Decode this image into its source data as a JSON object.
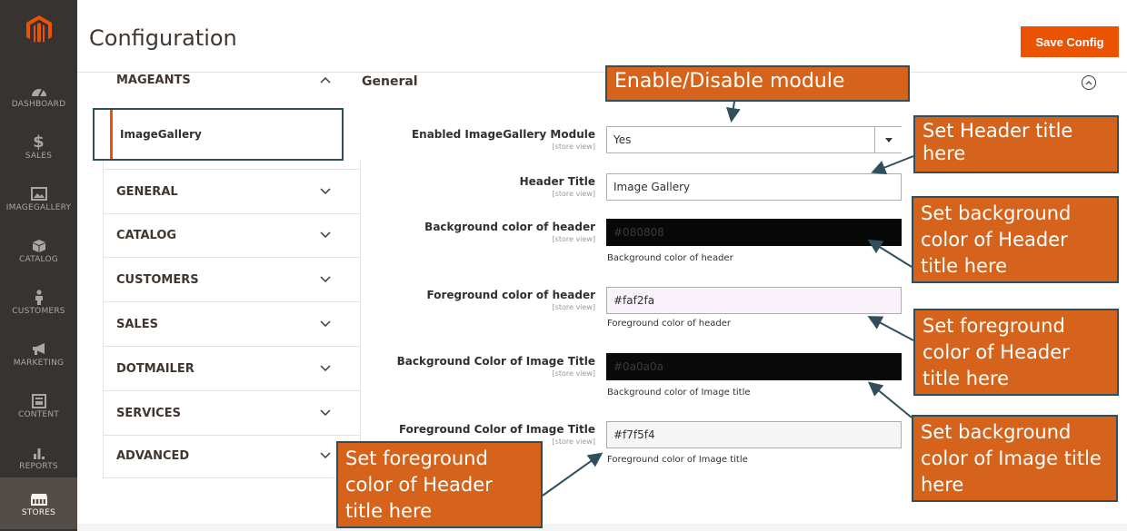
{
  "admin_nav": {
    "logo": "magento-logo",
    "items": [
      {
        "label": "DASHBOARD",
        "icon": "dashboard-icon"
      },
      {
        "label": "SALES",
        "icon": "dollar-icon"
      },
      {
        "label": "IMAGEGALLERY",
        "icon": "image-icon"
      },
      {
        "label": "CATALOG",
        "icon": "box-icon"
      },
      {
        "label": "CUSTOMERS",
        "icon": "person-icon"
      },
      {
        "label": "MARKETING",
        "icon": "megaphone-icon"
      },
      {
        "label": "CONTENT",
        "icon": "layout-icon"
      },
      {
        "label": "REPORTS",
        "icon": "bar-chart-icon"
      },
      {
        "label": "STORES",
        "icon": "store-icon",
        "active": true
      }
    ]
  },
  "header": {
    "title": "Configuration",
    "save_label": "Save Config"
  },
  "tabs": {
    "mageants": "MAGEANTS",
    "selected": "ImageGallery",
    "items": [
      "GENERAL",
      "CATALOG",
      "CUSTOMERS",
      "SALES",
      "DOTMAILER",
      "SERVICES",
      "ADVANCED"
    ]
  },
  "section": {
    "title": "General",
    "fields": [
      {
        "label": "Enabled ImageGallery Module",
        "scope": "[store view]",
        "value": "Yes",
        "type": "select"
      },
      {
        "label": "Header Title",
        "scope": "[store view]",
        "value": "Image Gallery"
      },
      {
        "label": "Background color of header",
        "scope": "[store view]",
        "value": "#080808",
        "note": "Background color of header",
        "bg": "#080808",
        "fg": "#3a3a3a"
      },
      {
        "label": "Foreground color of header",
        "scope": "[store view]",
        "value": "#faf2fa",
        "note": "Foreground color of header",
        "bg": "#faf2fa",
        "fg": "#303030"
      },
      {
        "label": "Background Color of Image Title",
        "scope": "[store view]",
        "value": "#0a0a0a",
        "note": "Background color of Image title",
        "bg": "#0a0a0a",
        "fg": "#3a3a3a"
      },
      {
        "label": "Foreground Color of Image Title",
        "scope": "[store view]",
        "value": "#f7f5f4",
        "note": "Foreground color of Image title",
        "bg": "#f7f5f4",
        "fg": "#303030"
      }
    ]
  },
  "callouts": {
    "enable": "Enable/Disable module",
    "header_title": "Set Header title here",
    "bg_header": "Set background color of Header title here",
    "fg_header": "Set foreground color of Header title here",
    "bg_image": "Set background color of Image title here",
    "fg_image": "Set foreground color of Header title here"
  },
  "colors": {
    "accent": "#eb5202",
    "callout": "#d5631b",
    "callout_border": "#2e4f5b",
    "admin_bar": "#373330"
  }
}
